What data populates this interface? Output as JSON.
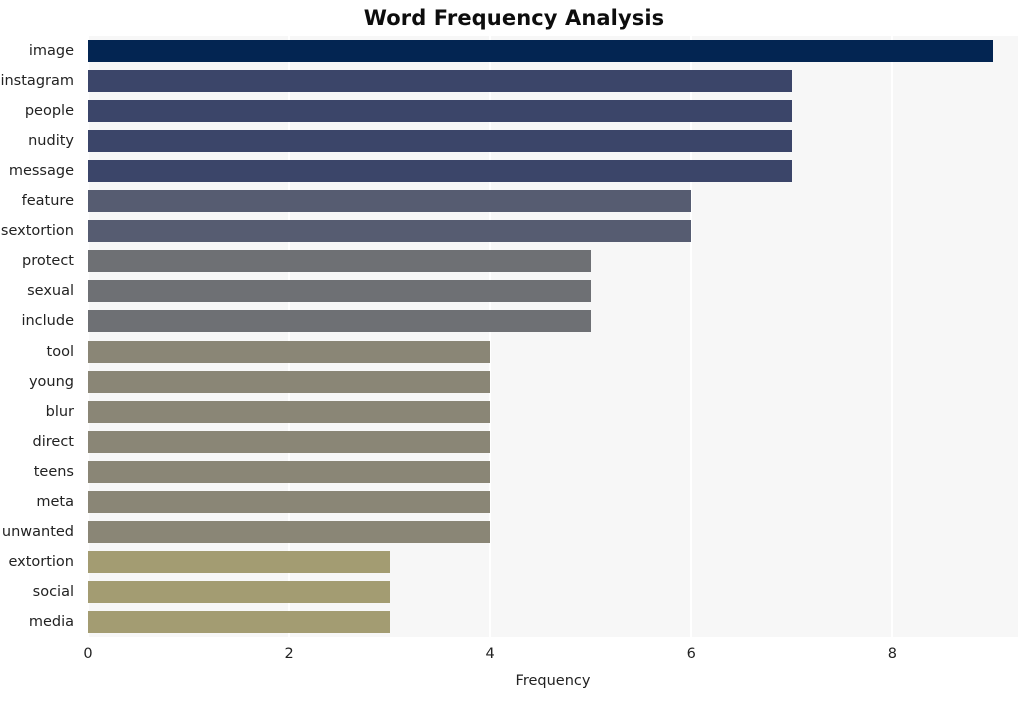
{
  "chart_data": {
    "type": "bar",
    "orientation": "horizontal",
    "title": "Word Frequency Analysis",
    "xlabel": "Frequency",
    "ylabel": "",
    "xlim": [
      0,
      9.25
    ],
    "xticks": [
      0,
      2,
      4,
      6,
      8
    ],
    "xticklabels": [
      "0",
      "2",
      "4",
      "6",
      "8"
    ],
    "grid": true,
    "grid_axis": "x",
    "legend": null,
    "categories": [
      "image",
      "instagram",
      "people",
      "nudity",
      "message",
      "feature",
      "sextortion",
      "protect",
      "sexual",
      "include",
      "tool",
      "young",
      "blur",
      "direct",
      "teens",
      "meta",
      "unwanted",
      "extortion",
      "social",
      "media"
    ],
    "values": [
      9,
      7,
      7,
      7,
      7,
      6,
      6,
      5,
      5,
      5,
      4,
      4,
      4,
      4,
      4,
      4,
      4,
      3,
      3,
      3
    ],
    "bar_colors": [
      "#032552",
      "#3b4569",
      "#3b4569",
      "#3b4569",
      "#3b4569",
      "#565c71",
      "#565c71",
      "#6e7074",
      "#6e7074",
      "#6e7074",
      "#8a8676",
      "#8a8676",
      "#8a8676",
      "#8a8676",
      "#8a8676",
      "#8a8676",
      "#8a8676",
      "#a39c72",
      "#a39c72",
      "#a39c72"
    ]
  },
  "style": {
    "figure_background": "#ffffff",
    "axes_background": "#f7f7f7",
    "gridline_color": "#ffffff",
    "text_color": "#222222",
    "title_color": "#0d0d0d"
  }
}
